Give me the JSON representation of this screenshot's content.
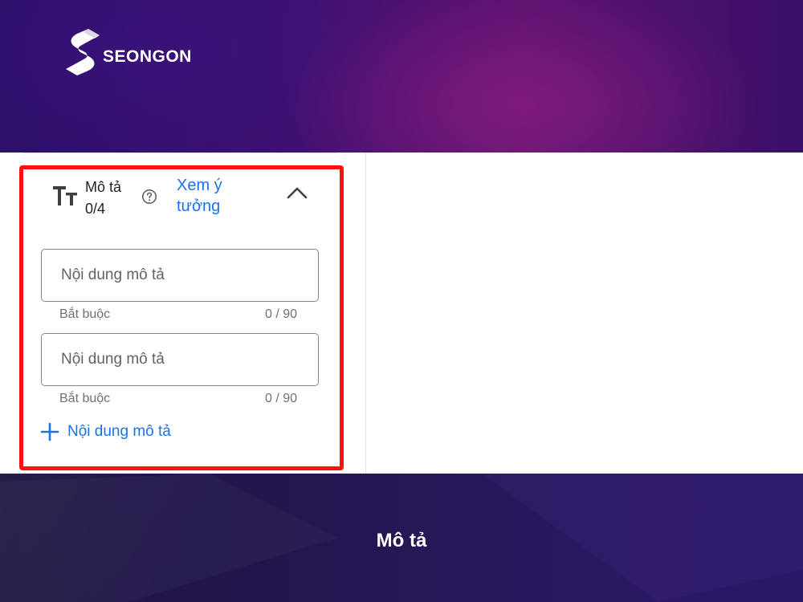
{
  "brand": {
    "name": "SEONGON"
  },
  "panel": {
    "section_title": "Mô tả",
    "section_count": "0/4",
    "ideas_link": "Xem ý tưởng",
    "fields": [
      {
        "placeholder": "Nội dung mô tả",
        "value": "",
        "hint": "Bắt buộc",
        "counter": "0 / 90"
      },
      {
        "placeholder": "Nội dung mô tả",
        "value": "",
        "hint": "Bắt buộc",
        "counter": "0 / 90"
      }
    ],
    "add_button_label": "Nội dung mô tả"
  },
  "caption": "Mô tả",
  "colors": {
    "highlight": "#ff1010",
    "link": "#1a73e8",
    "text": "#202124",
    "hint": "#6d7175"
  },
  "icons": {
    "text_format": "text-format-icon",
    "help": "help-circle-icon",
    "collapse": "chevron-up-icon",
    "add": "plus-icon"
  }
}
